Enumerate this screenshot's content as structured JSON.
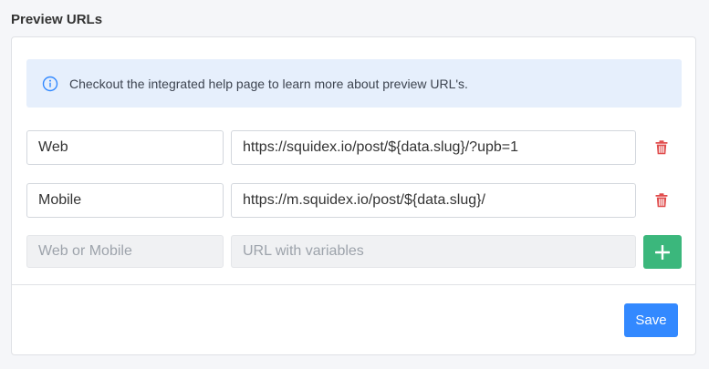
{
  "page": {
    "title": "Preview URLs"
  },
  "info": {
    "icon": "info-circle-icon",
    "text": "Checkout the integrated help page to learn more about preview URL's."
  },
  "rows": [
    {
      "name": "Web",
      "url": "https://squidex.io/post/${data.slug}/?upb=1",
      "delete_icon": "trash-icon"
    },
    {
      "name": "Mobile",
      "url": "https://m.squidex.io/post/${data.slug}/",
      "delete_icon": "trash-icon"
    }
  ],
  "new_row": {
    "name_placeholder": "Web or Mobile",
    "url_placeholder": "URL with variables",
    "add_icon": "plus-icon"
  },
  "footer": {
    "save_label": "Save"
  },
  "colors": {
    "accent": "#3389ff",
    "success": "#3bb77c",
    "danger": "#e04c4c",
    "info_bg": "#e6effc"
  }
}
